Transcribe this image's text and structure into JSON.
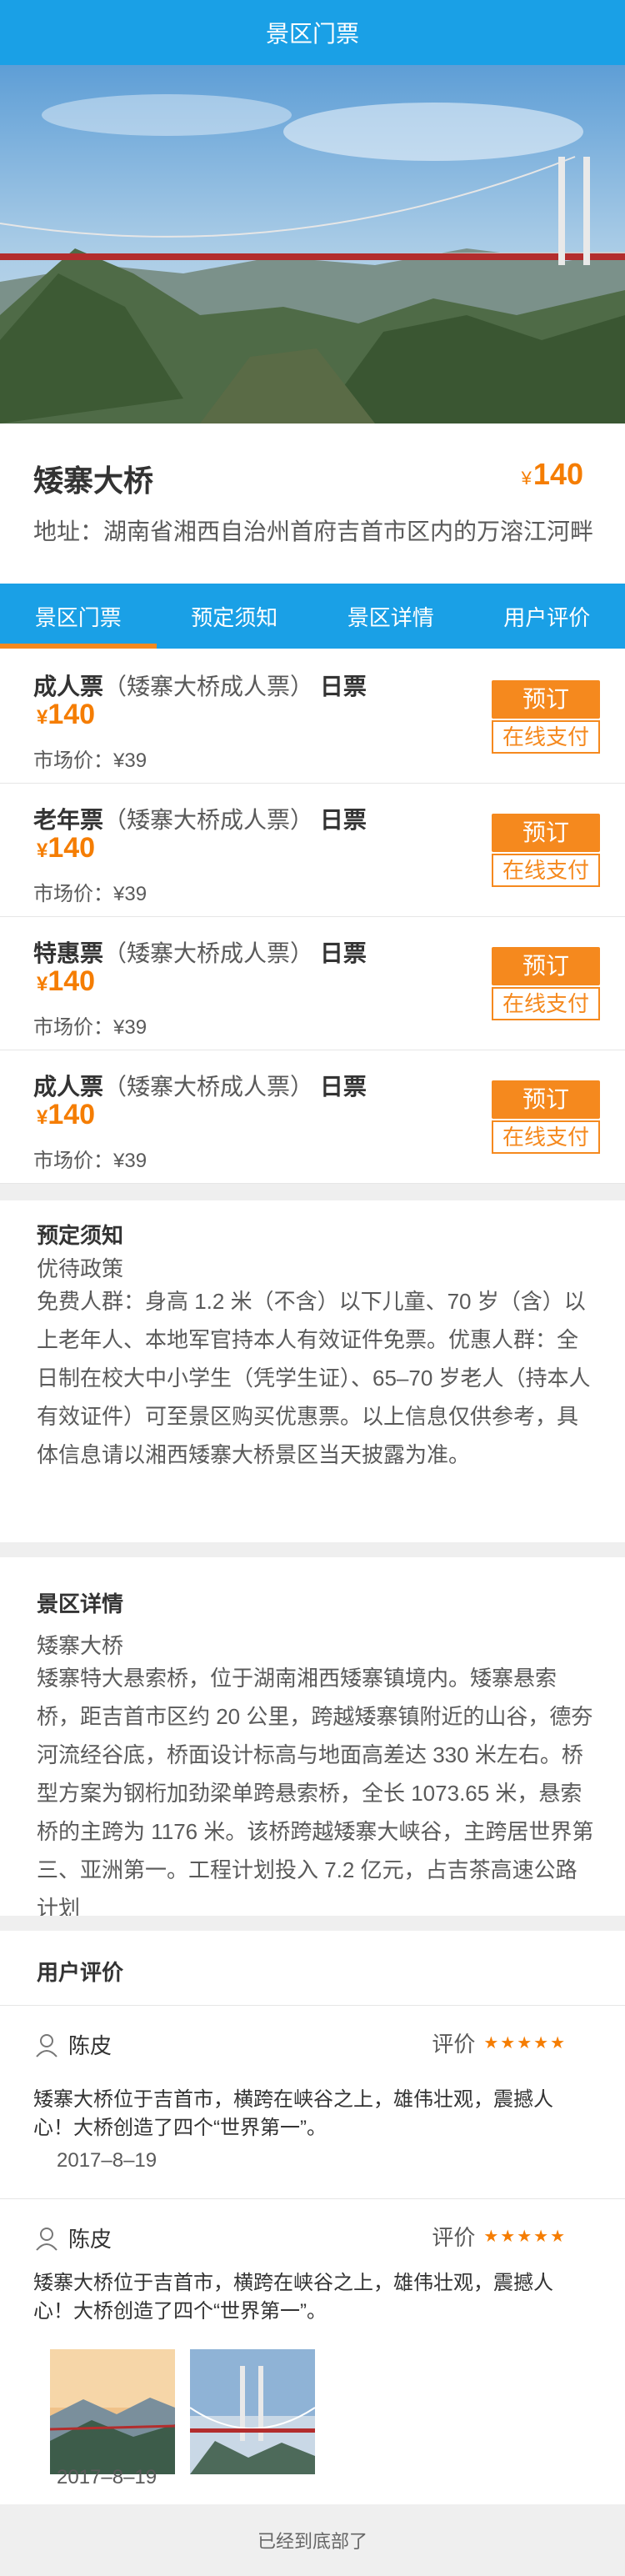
{
  "header": {
    "title": "景区门票"
  },
  "attraction": {
    "name": "矮寨大桥",
    "address": "地址：湖南省湘西自治州首府吉首市区内的万溶江河畔",
    "price_symbol": "¥",
    "price": "140"
  },
  "tabs": [
    {
      "label": "景区门票",
      "active": true
    },
    {
      "label": "预定须知",
      "active": false
    },
    {
      "label": "景区详情",
      "active": false
    },
    {
      "label": "用户评价",
      "active": false
    }
  ],
  "tickets": [
    {
      "type": "成人票",
      "desc": "（矮寨大桥成人票）",
      "day": "日票",
      "price_symbol": "¥",
      "price": "140",
      "market": "市场价：¥39",
      "book": "预订",
      "pay": "在线支付"
    },
    {
      "type": "老年票",
      "desc": "（矮寨大桥成人票）",
      "day": "日票",
      "price_symbol": "¥",
      "price": "140",
      "market": "市场价：¥39",
      "book": "预订",
      "pay": "在线支付"
    },
    {
      "type": "特惠票",
      "desc": "（矮寨大桥成人票）",
      "day": "日票",
      "price_symbol": "¥",
      "price": "140",
      "market": "市场价：¥39",
      "book": "预订",
      "pay": "在线支付"
    },
    {
      "type": "成人票",
      "desc": "（矮寨大桥成人票）",
      "day": "日票",
      "price_symbol": "¥",
      "price": "140",
      "market": "市场价：¥39",
      "book": "预订",
      "pay": "在线支付"
    }
  ],
  "notice": {
    "title": "预定须知",
    "subtitle": "优待政策",
    "body": "免费人群：身高 1.2 米（不含）以下儿童、70 岁（含）以上老年人、本地军官持本人有效证件免票。优惠人群：全日制在校大中小学生（凭学生证）、65–70 岁老人（持本人有效证件）可至景区购买优惠票。以上信息仅供参考，具体信息请以湘西矮寨大桥景区当天披露为准。"
  },
  "details": {
    "title": "景区详情",
    "subtitle": "矮寨大桥",
    "body": "矮寨特大悬索桥，位于湖南湘西矮寨镇境内。矮寨悬索桥，距吉首市区约 20 公里，跨越矮寨镇附近的山谷，德夯河流经谷底，桥面设计标高与地面高差达 330 米左右。桥型方案为钢桁加劲梁单跨悬索桥，全长 1073.65 米，悬索桥的主跨为 1176 米。该桥跨越矮寨大峡谷，主跨居世界第三、亚洲第一。工程计划投入 7.2 亿元，占吉茶高速公路计划"
  },
  "reviews": {
    "title": "用户评价",
    "rating_label": "评价",
    "items": [
      {
        "user": "陈皮",
        "stars": "★★★★★",
        "text": "矮寨大桥位于吉首市，横跨在峡谷之上，雄伟壮观，震撼人心！大桥创造了四个“世界第一”。",
        "date": "2017–8–19"
      },
      {
        "user": "陈皮",
        "stars": "★★★★★",
        "text": "矮寨大桥位于吉首市，横跨在峡谷之上，雄伟壮观，震撼人心！大桥创造了四个“世界第一”。",
        "date": "2017–8–19"
      }
    ]
  },
  "footer": {
    "text": "已经到底部了"
  },
  "colors": {
    "brand_blue": "#1aa0e6",
    "accent_orange": "#f57d02",
    "button_orange": "#f5891e",
    "text_gray": "#5a5a5a"
  }
}
